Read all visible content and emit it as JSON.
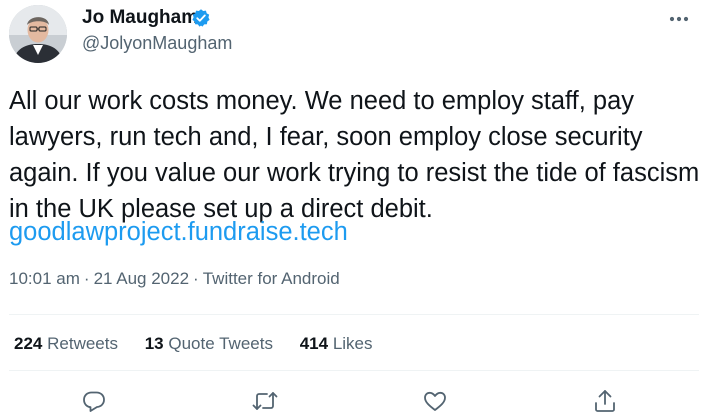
{
  "author": {
    "name": "Jo Maugham",
    "handle": "@JolyonMaugham",
    "verified_color": "#1d9bf0"
  },
  "tweet": {
    "text": "All our work costs money. We need to employ staff, pay lawyers, run tech and, I fear, soon employ close security again. If you value our work trying to resist the tide of fascism in the UK please set up a direct debit.",
    "link": "goodlawproject.fundraise.tech",
    "time": "10:01 am",
    "date": "21 Aug 2022",
    "source": "Twitter for Android",
    "separator": "·"
  },
  "stats": {
    "retweets_count": "224",
    "retweets_label": "Retweets",
    "quotes_count": "13",
    "quotes_label": "Quote Tweets",
    "likes_count": "414",
    "likes_label": "Likes"
  },
  "icons": {
    "more": "more-icon",
    "reply": "reply-icon",
    "retweet": "retweet-icon",
    "like": "like-icon",
    "share": "share-icon"
  },
  "colors": {
    "text": "#0f1419",
    "secondary": "#536471",
    "link": "#1d9bf0",
    "divider": "#eff3f4"
  }
}
